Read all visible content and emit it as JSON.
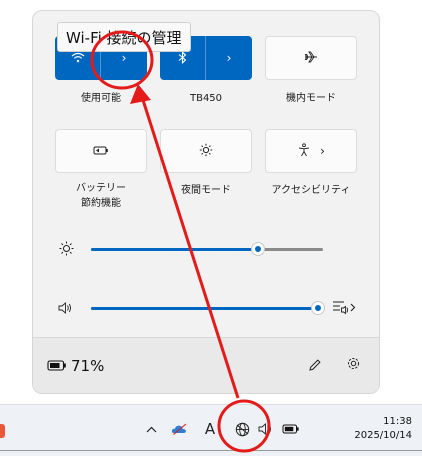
{
  "tooltip": {
    "text": "Wi-Fi 接続の管理"
  },
  "tiles": {
    "wifi": {
      "label": "使用可能",
      "icon": "wifi-icon",
      "state": "on"
    },
    "bluetooth": {
      "label": "TB450",
      "icon": "bluetooth-icon",
      "state": "on"
    },
    "airplane": {
      "label": "機内モード",
      "icon": "airplane-icon",
      "state": "off"
    },
    "battery_saver": {
      "label_line1": "バッテリー",
      "label_line2": "節約機能",
      "icon": "battery-saver-icon",
      "state": "off"
    },
    "night_light": {
      "label": "夜間モード",
      "icon": "night-light-icon",
      "state": "off"
    },
    "accessibility": {
      "label": "アクセシビリティ",
      "icon": "accessibility-icon",
      "state": "off"
    }
  },
  "brightness": {
    "icon": "brightness-icon",
    "level_percent": 72
  },
  "volume": {
    "icon": "speaker-icon",
    "level_percent": 100,
    "output_icon": "audio-output-icon"
  },
  "footer": {
    "battery_text": "71%",
    "battery_icon": "battery-icon",
    "edit_icon": "pencil-icon",
    "settings_icon": "gear-icon"
  },
  "taskbar": {
    "chevron": "^",
    "ime_indicator": "A",
    "time": "11:38",
    "date": "2025/10/14"
  },
  "colors": {
    "accent": "#0067c0",
    "annotation": "#e31b1b"
  }
}
